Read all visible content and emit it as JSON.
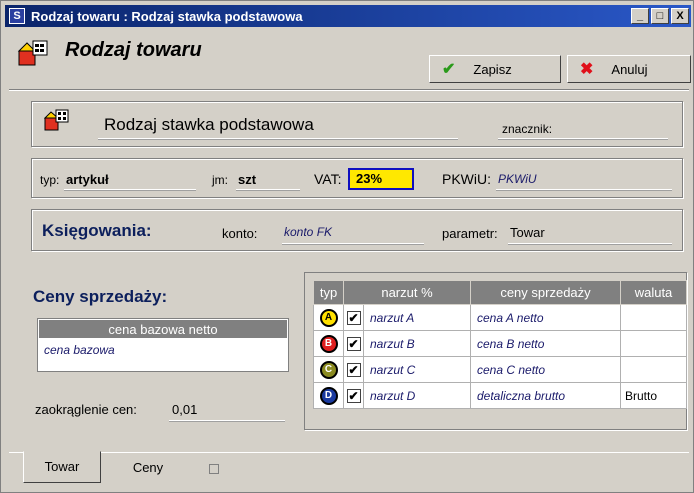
{
  "window": {
    "title_icon": "S",
    "title": "Rodzaj towaru : Rodzaj stawka podstawowa",
    "controls": {
      "minimize": "_",
      "maximize": "□",
      "close": "X"
    }
  },
  "header": {
    "title": "Rodzaj towaru",
    "save_label": "Zapisz",
    "cancel_label": "Anuluj",
    "save_icon": "✔",
    "cancel_icon": "✖"
  },
  "group1": {
    "name_value": "Rodzaj stawka podstawowa",
    "znacznik_label": "znacznik:"
  },
  "group2": {
    "typ_label": "typ:",
    "typ_value": "artykuł",
    "jm_label": "jm:",
    "jm_value": "szt",
    "vat_label": "VAT:",
    "vat_value": "23%",
    "pkwiu_label": "PKWiU:",
    "pkwiu_placeholder": "PKWiU"
  },
  "group3": {
    "title": "Księgowania:",
    "konto_label": "konto:",
    "konto_placeholder": "konto FK",
    "parametr_label": "parametr:",
    "parametr_value": "Towar"
  },
  "prices": {
    "title": "Ceny sprzedaży:",
    "base_header": "cena bazowa netto",
    "base_value": "cena bazowa",
    "rounding_label": "zaokrąglenie cen:",
    "rounding_value": "0,01"
  },
  "price_table": {
    "columns": [
      "typ",
      "narzut %",
      "ceny sprzedaży",
      "waluta"
    ],
    "rows": [
      {
        "badge": "A",
        "badge_color": "#ffe000",
        "narzut": "narzut A",
        "cena": "cena A netto",
        "waluta": ""
      },
      {
        "badge": "B",
        "badge_color": "#e02020",
        "narzut": "narzut B",
        "cena": "cena B netto",
        "waluta": ""
      },
      {
        "badge": "C",
        "badge_color": "#8a8a20",
        "narzut": "narzut C",
        "cena": "cena C netto",
        "waluta": ""
      },
      {
        "badge": "D",
        "badge_color": "#1a3aa0",
        "narzut": "narzut D",
        "cena": "detaliczna brutto",
        "waluta": "Brutto"
      }
    ]
  },
  "tabs": [
    "Towar",
    "Ceny"
  ]
}
